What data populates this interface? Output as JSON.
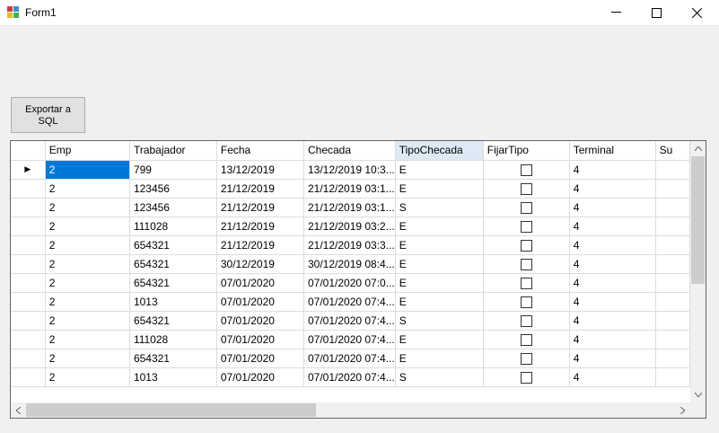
{
  "window": {
    "title": "Form1",
    "minimize": "—",
    "maximize": "☐",
    "close": "✕"
  },
  "export_button": {
    "line1": "Exportar a",
    "line2": "SQL"
  },
  "grid": {
    "columns": [
      "Emp",
      "Trabajador",
      "Fecha",
      "Checada",
      "TipoChecada",
      "FijarTipo",
      "Terminal",
      "Su"
    ],
    "rows": [
      {
        "emp": "2",
        "trabajador": "799",
        "fecha": "13/12/2019",
        "checada": "13/12/2019 10:3...",
        "tipo": "E",
        "terminal": "4"
      },
      {
        "emp": "2",
        "trabajador": "123456",
        "fecha": "21/12/2019",
        "checada": "21/12/2019 03:1...",
        "tipo": "E",
        "terminal": "4"
      },
      {
        "emp": "2",
        "trabajador": "123456",
        "fecha": "21/12/2019",
        "checada": "21/12/2019 03:1...",
        "tipo": "S",
        "terminal": "4"
      },
      {
        "emp": "2",
        "trabajador": "111028",
        "fecha": "21/12/2019",
        "checada": "21/12/2019 03:2...",
        "tipo": "E",
        "terminal": "4"
      },
      {
        "emp": "2",
        "trabajador": "654321",
        "fecha": "21/12/2019",
        "checada": "21/12/2019 03:3...",
        "tipo": "E",
        "terminal": "4"
      },
      {
        "emp": "2",
        "trabajador": "654321",
        "fecha": "30/12/2019",
        "checada": "30/12/2019 08:4...",
        "tipo": "E",
        "terminal": "4"
      },
      {
        "emp": "2",
        "trabajador": "654321",
        "fecha": "07/01/2020",
        "checada": "07/01/2020 07:0...",
        "tipo": "E",
        "terminal": "4"
      },
      {
        "emp": "2",
        "trabajador": "1013",
        "fecha": "07/01/2020",
        "checada": "07/01/2020 07:4...",
        "tipo": "E",
        "terminal": "4"
      },
      {
        "emp": "2",
        "trabajador": "654321",
        "fecha": "07/01/2020",
        "checada": "07/01/2020 07:4...",
        "tipo": "S",
        "terminal": "4"
      },
      {
        "emp": "2",
        "trabajador": "111028",
        "fecha": "07/01/2020",
        "checada": "07/01/2020 07:4...",
        "tipo": "E",
        "terminal": "4"
      },
      {
        "emp": "2",
        "trabajador": "654321",
        "fecha": "07/01/2020",
        "checada": "07/01/2020 07:4...",
        "tipo": "E",
        "terminal": "4"
      },
      {
        "emp": "2",
        "trabajador": "1013",
        "fecha": "07/01/2020",
        "checada": "07/01/2020 07:4...",
        "tipo": "S",
        "terminal": "4"
      }
    ],
    "current_row_marker": "▶",
    "selected_header": "TipoChecada",
    "selection_color": "#0078d7"
  }
}
